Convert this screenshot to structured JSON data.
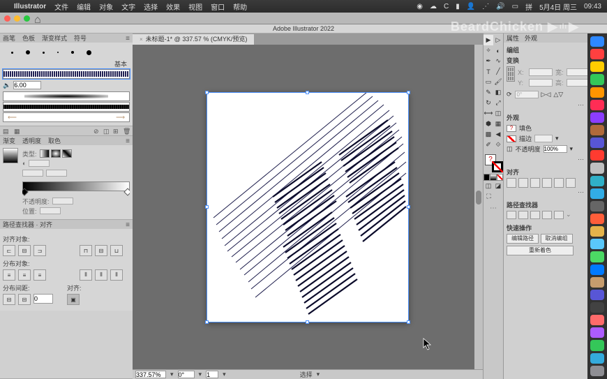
{
  "menubar": {
    "apple": "",
    "app": "Illustrator",
    "items": [
      "文件",
      "编辑",
      "对象",
      "文字",
      "选择",
      "效果",
      "视图",
      "窗口",
      "帮助"
    ],
    "right_icons": [
      "record",
      "cloud",
      "cc",
      "wifi-sig",
      "user",
      "wifi",
      "volume",
      "battery",
      "lang",
      "date",
      "time"
    ],
    "date": "5月4日 周三",
    "time": "09:43"
  },
  "toolbar": {
    "home": "⌂"
  },
  "title": "Adobe Illustrator 2022",
  "doc_tab": {
    "name": "未标题-1* @ 337.57 % (CMYK/预览)",
    "close": "×"
  },
  "left": {
    "brushes": {
      "tabs": [
        "画笔",
        "色板",
        "渐变样式",
        "符号"
      ],
      "basic_label": "基本",
      "size_value": "6.00"
    },
    "gradient": {
      "tabs": [
        "渐变",
        "透明度",
        "取色"
      ],
      "type_label": "类型:",
      "opacity_label": "不透明度:",
      "position_label": "位置:"
    },
    "pathfinder_hdr": "路径查找器 · 对齐",
    "align": {
      "align_label": "对齐对象:",
      "distribute_label": "分布对象:",
      "spacing_label": "分布间距:",
      "align_to_label": "对齐:",
      "spacing_value": "0"
    }
  },
  "status": {
    "zoom": "337.57%",
    "rotate": "0°",
    "select_label": "选择",
    "nav": "1"
  },
  "props": {
    "tabs": [
      "属性",
      "外观"
    ],
    "section_group": "编组",
    "section_transform": "变换",
    "x_label": "X:",
    "y_label": "Y:",
    "w_label": "宽:",
    "h_label": "高:",
    "rotate": "0°",
    "section_appearance": "外观",
    "fill_label": "填色",
    "stroke_label": "描边",
    "opacity_label": "不透明度",
    "opacity_value": "100%",
    "section_align": "对齐",
    "section_pathfinder": "路径查找器",
    "section_quick": "快速操作",
    "btn_isolate": "编辑路径",
    "btn_ungroup": "取消编组",
    "btn_recolor": "重新着色"
  },
  "watermark": {
    "name": "BeardChicken",
    "bili": "bilibili"
  },
  "dock_colors": [
    "#2d88ff",
    "#ff4040",
    "#ffcc00",
    "#34c759",
    "#ff9500",
    "#ff2d55",
    "#8b3dff",
    "#b06a3b",
    "#5856d6",
    "#ff3b30",
    "#c0c0c0",
    "#30b0c7",
    "#32ade6",
    "#666",
    "#ff5e3a",
    "#e5b34a",
    "#5ac8fa",
    "#4cd964",
    "#007aff",
    "#c69c6d",
    "#5856d6",
    "#424242",
    "#ff6b6b",
    "#ad5cff",
    "#34c759",
    "#34aadc",
    "#8e8e93"
  ]
}
